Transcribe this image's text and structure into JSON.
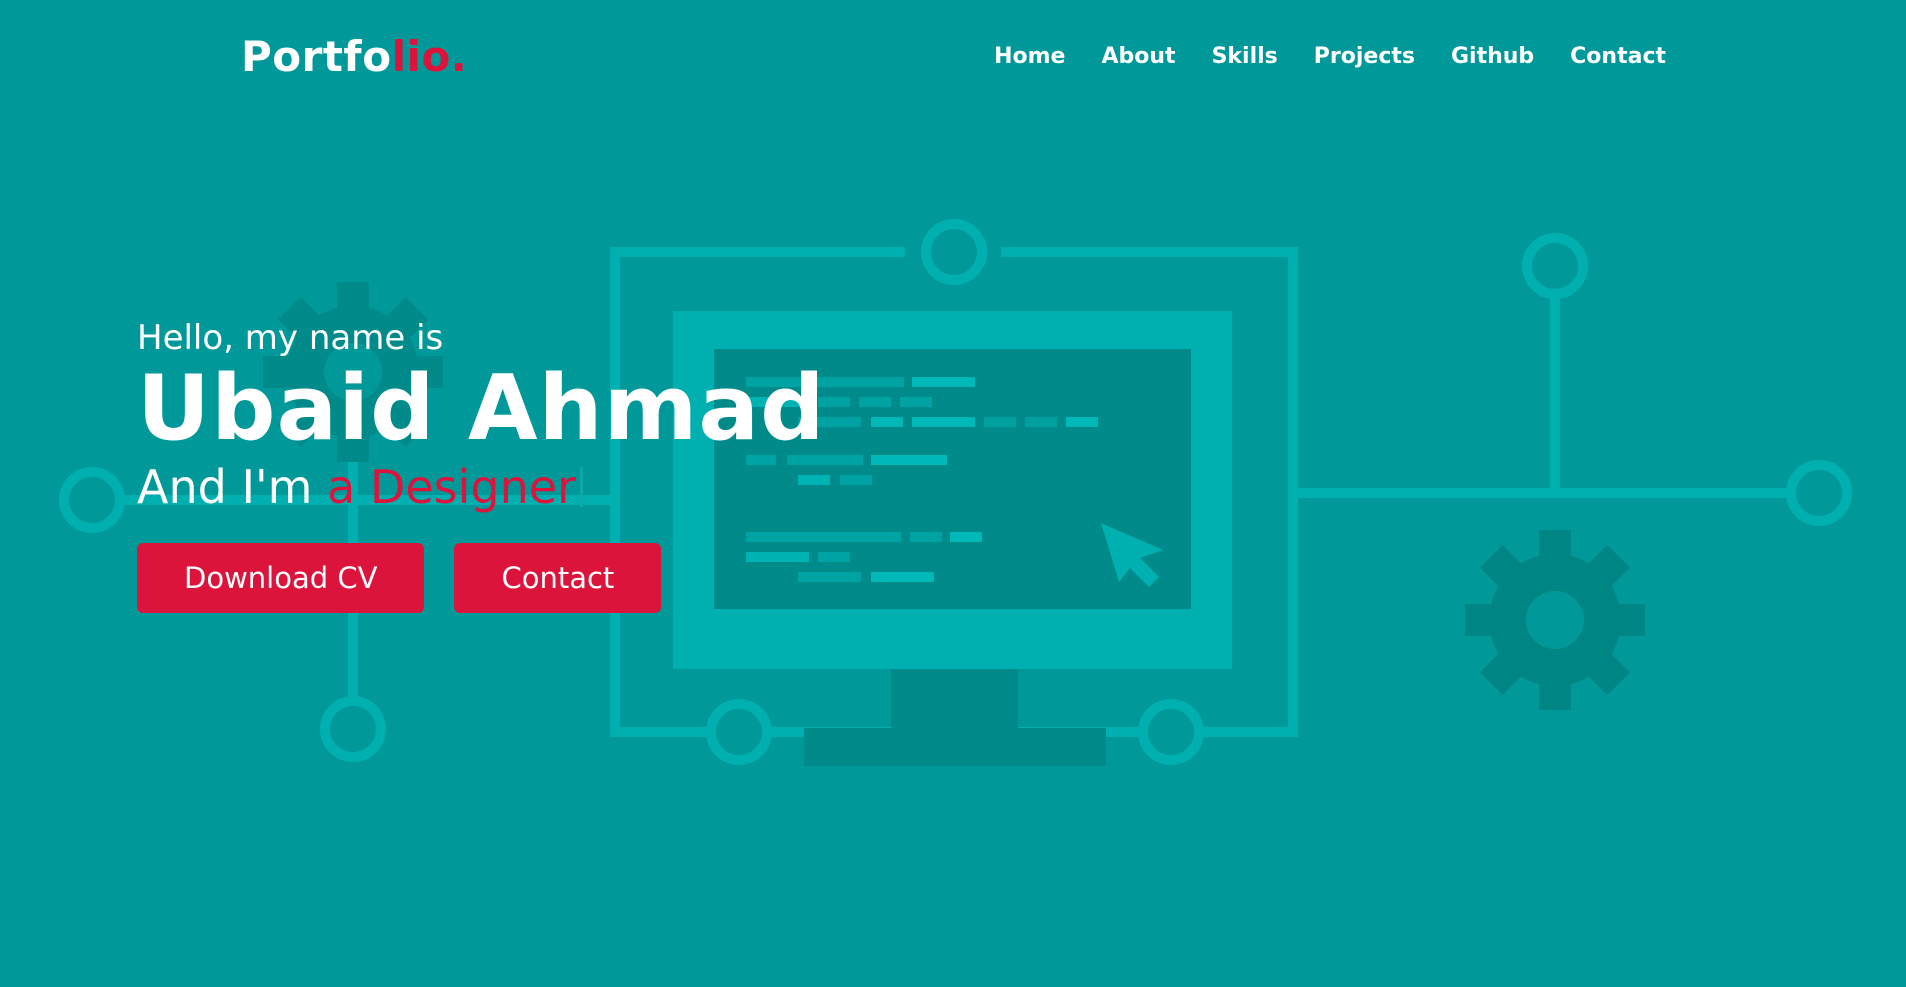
{
  "logo": {
    "main": "Portfo",
    "accent": "lio."
  },
  "nav": {
    "items": [
      {
        "label": "Home"
      },
      {
        "label": "About"
      },
      {
        "label": "Skills"
      },
      {
        "label": "Projects"
      },
      {
        "label": "Github"
      },
      {
        "label": "Contact"
      }
    ]
  },
  "hero": {
    "greeting": "Hello, my name is",
    "name": "Ubaid Ahmad",
    "role_prefix": "And I'm ",
    "role_typed": "a Designer",
    "buttons": {
      "download": "Download CV",
      "contact": "Contact"
    }
  },
  "colors": {
    "background": "#009898",
    "accent": "#dc143c",
    "text": "#ffffff"
  },
  "icons": [
    "monitor-illustration-icon",
    "gear-icon",
    "cursor-arrow-icon",
    "circuit-node-icon"
  ]
}
